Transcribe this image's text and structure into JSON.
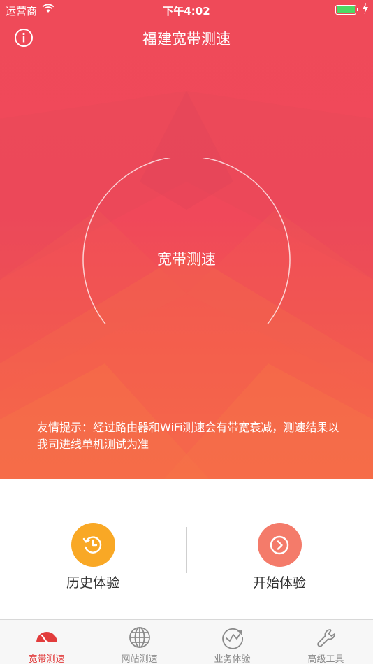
{
  "status_bar": {
    "carrier": "运营商",
    "time": "下午4:02"
  },
  "header": {
    "title": "福建宽带测速"
  },
  "gauge": {
    "label": "宽带测速"
  },
  "tip": {
    "text": "友情提示：经过路由器和WiFi测速会有带宽衰减，测速结果以我司进线单机测试为准"
  },
  "actions": {
    "history_label": "历史体验",
    "start_label": "开始体验"
  },
  "tabs": [
    {
      "label": "宽带测速",
      "icon": "speedometer-icon",
      "active": true
    },
    {
      "label": "网站测速",
      "icon": "globe-icon",
      "active": false
    },
    {
      "label": "业务体验",
      "icon": "trend-chart-icon",
      "active": false
    },
    {
      "label": "高级工具",
      "icon": "wrench-icon",
      "active": false
    }
  ],
  "colors": {
    "hero_top": "#ef4a59",
    "hero_bottom": "#f7684a",
    "history": "#f9a825",
    "start": "#f47b6a",
    "tab_active": "#e23c3c",
    "tab_inactive": "#8a8a8a"
  }
}
